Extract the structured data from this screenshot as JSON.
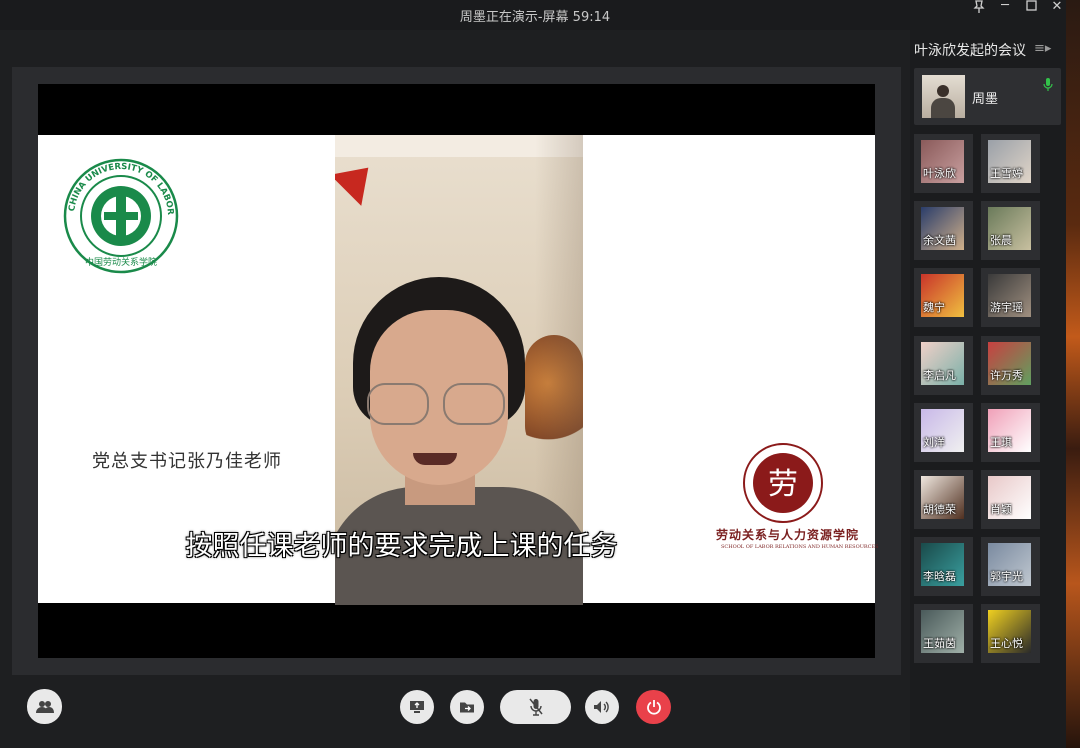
{
  "window": {
    "title": "周墨正在演示-屏幕 59:14"
  },
  "meeting": {
    "title": "叶泳欣发起的会议",
    "presenter": "周墨"
  },
  "participants": [
    "叶泳欣",
    "王雪婷",
    "余文茜",
    "张晨",
    "魏宁",
    "游宇瑶",
    "李启凡",
    "许万秀",
    "刘洋",
    "王琪",
    "胡德荣",
    "肖颖",
    "李晗磊",
    "郭宇光",
    "王茹茵",
    "王心悦"
  ],
  "slide": {
    "caption": "党总支书记张乃佳老师",
    "subtitle": "按照任课老师的要求完成上课的任务",
    "school_cn": "劳动关系与人力资源学院",
    "school_en": "SCHOOL OF LABOR RELATIONS AND HUMAN RESOURCES",
    "logo_left_text": "CHINA UNIVERSITY OF LABOR RELATIONS · 中国劳动关系学院"
  },
  "colors": {
    "logo_green": "#1a8a4a",
    "logo_red": "#8b1a1a",
    "end_button": "#e9414a"
  },
  "icons": {
    "participants": "people-icon",
    "share": "share-screen-icon",
    "file": "file-transfer-icon",
    "mic": "mic-muted-icon",
    "speaker": "speaker-icon",
    "end": "power-icon"
  }
}
